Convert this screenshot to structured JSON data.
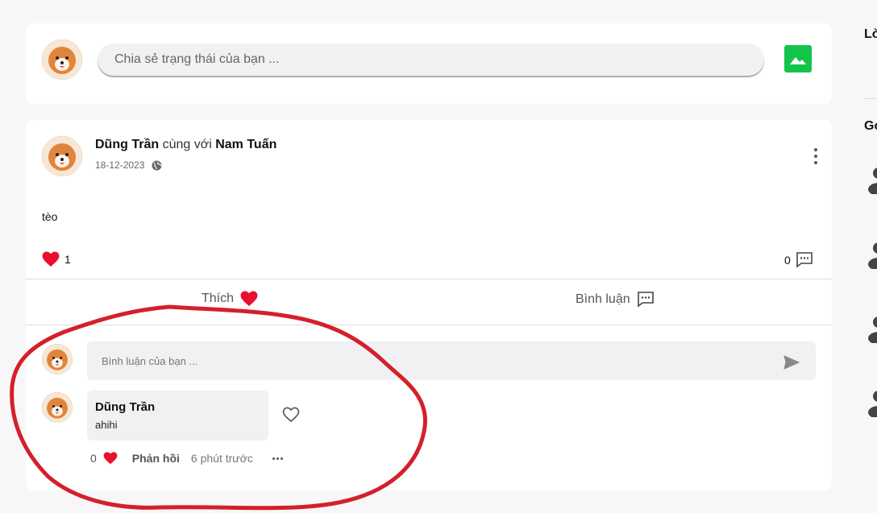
{
  "composer": {
    "placeholder": "Chia sẻ trạng thái của bạn ..."
  },
  "post": {
    "author": "Dũng Trần",
    "with_text": "cùng với",
    "tagged": "Nam Tuấn",
    "date": "18-12-2023",
    "content": "tèo",
    "like_count": "1",
    "comment_count": "0",
    "like_label": "Thích",
    "comment_label": "Bình luận"
  },
  "comment_box": {
    "placeholder": "Bình luận của bạn ..."
  },
  "comment": {
    "author": "Dũng Trần",
    "text": "ahihi",
    "like_count": "0",
    "reply_label": "Phản hồi",
    "time": "6 phút trước"
  },
  "right_panel": {
    "label_1": "Lờ",
    "label_2": "Gợ"
  },
  "colors": {
    "heart": "#e8112d",
    "image_button": "#12c54a",
    "annotation": "#d4202a"
  }
}
